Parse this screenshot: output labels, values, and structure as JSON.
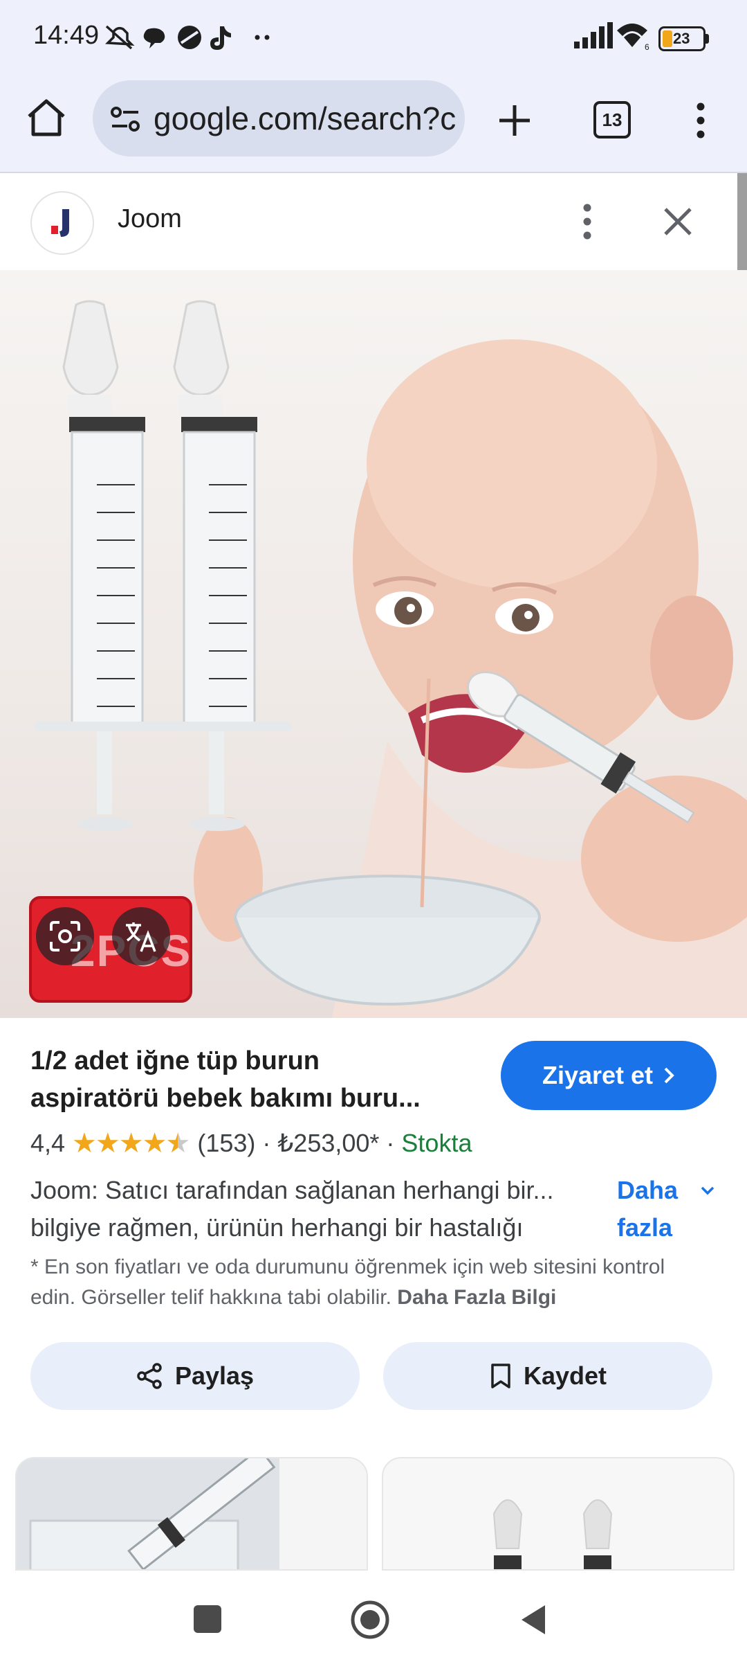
{
  "status_bar": {
    "time": "14:49",
    "battery": "23"
  },
  "browser": {
    "url": "google.com/search?c",
    "tab_count": "13"
  },
  "panel": {
    "brand": "Joom"
  },
  "image_overlay": {
    "badge_text": "2PCS"
  },
  "product": {
    "title_line1": "1/2 adet iğne tüp burun",
    "title_line2": "aspiratörü bebek bakımı buru...",
    "visit_label": "Ziyaret et",
    "rating": "4,4",
    "stars": "★★★★",
    "review_count": "(153)",
    "price": "₺253,00*",
    "availability": "Stokta",
    "desc_line1": "Joom: Satıcı tarafından sağlanan herhangi bir...",
    "desc_line2": "bilgiye rağmen, ürünün herhangi bir hastalığı",
    "more_line1": "Daha",
    "more_line2": "fazla",
    "note_text": "* En son fiyatları ve oda durumunu öğrenmek için web sitesini kontrol edin. Görseller telif hakkına tabi olabilir.",
    "note_link": "Daha Fazla Bilgi"
  },
  "actions": {
    "share_label": "Paylaş",
    "save_label": "Kaydet"
  },
  "colors": {
    "accent": "#1a73e8",
    "stock": "#188038",
    "badge": "#e0202b"
  }
}
